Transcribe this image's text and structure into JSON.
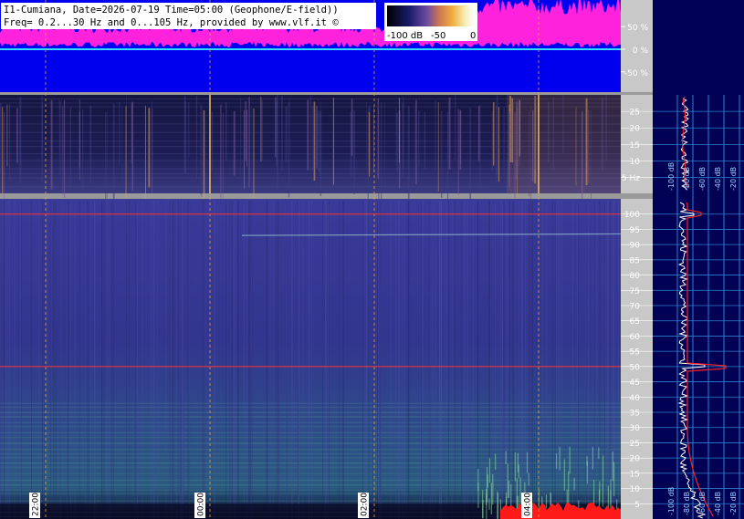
{
  "header": {
    "line1": "I1-Cumiana, Date=2026-07-19 Time=05:00 (Geophone/E-field))",
    "line2": "Freq= 0.2...30 Hz and 0...105 Hz, provided by www.vlf.it ©"
  },
  "colorbar": {
    "tick_labels": [
      "-100 dB",
      "-50",
      "0"
    ]
  },
  "colors": {
    "amplitude_magenta": "#ff22dd",
    "amplitude_background": "#0000ee",
    "zero_line": "#33ddff",
    "panel_separator": "#9a9a9a",
    "grid_vertical": "#e8a040",
    "marker_red": "#ff3030",
    "spectrum_bg_low": "#2a2a7a",
    "spectrum_bg_high": "#0b0b2e",
    "side_background": "#000055",
    "profile_grid": "#2f7fcf",
    "profile_white": "#ffffff",
    "profile_red": "#ff2020",
    "axis_panel": "#c8c8c8"
  },
  "chart_data": [
    {
      "type": "area",
      "panel": "amplitude",
      "ylabel_ticks": [
        "50 %",
        "0 %",
        "-50 %"
      ],
      "y_ticks": [
        50,
        0,
        -50
      ],
      "ylim": [
        -105,
        105
      ],
      "xlim": [
        0,
        1
      ]
    },
    {
      "type": "heatmap",
      "panel": "spectrogram_low",
      "y_ticks": [
        25,
        20,
        15,
        10,
        5
      ],
      "tick_labels": [
        "25",
        "20",
        "15",
        "10",
        "5 Hz"
      ],
      "ylim": [
        0.2,
        30
      ]
    },
    {
      "type": "heatmap",
      "panel": "spectrogram_high",
      "y_ticks": [
        100,
        95,
        90,
        85,
        80,
        75,
        70,
        65,
        60,
        55,
        50,
        45,
        40,
        35,
        30,
        25,
        20,
        15,
        10,
        5
      ],
      "tick_labels": [
        "100",
        "95",
        "90",
        "85",
        "80",
        "75",
        "70",
        "65",
        "60",
        "55",
        "50",
        "45",
        "40",
        "35",
        "30",
        "25",
        "20",
        "15",
        "10",
        "5"
      ],
      "ylim": [
        0,
        105
      ],
      "x_ticks": [
        "22:00",
        "00:00",
        "02:00",
        "04:00"
      ],
      "markers_hz": [
        100,
        50
      ]
    },
    {
      "type": "line",
      "panel": "side_profile",
      "x_tick_labels": [
        "-100 dB",
        "-80 dB",
        "-60 dB",
        "-40 dB",
        "-20 dB"
      ]
    }
  ]
}
